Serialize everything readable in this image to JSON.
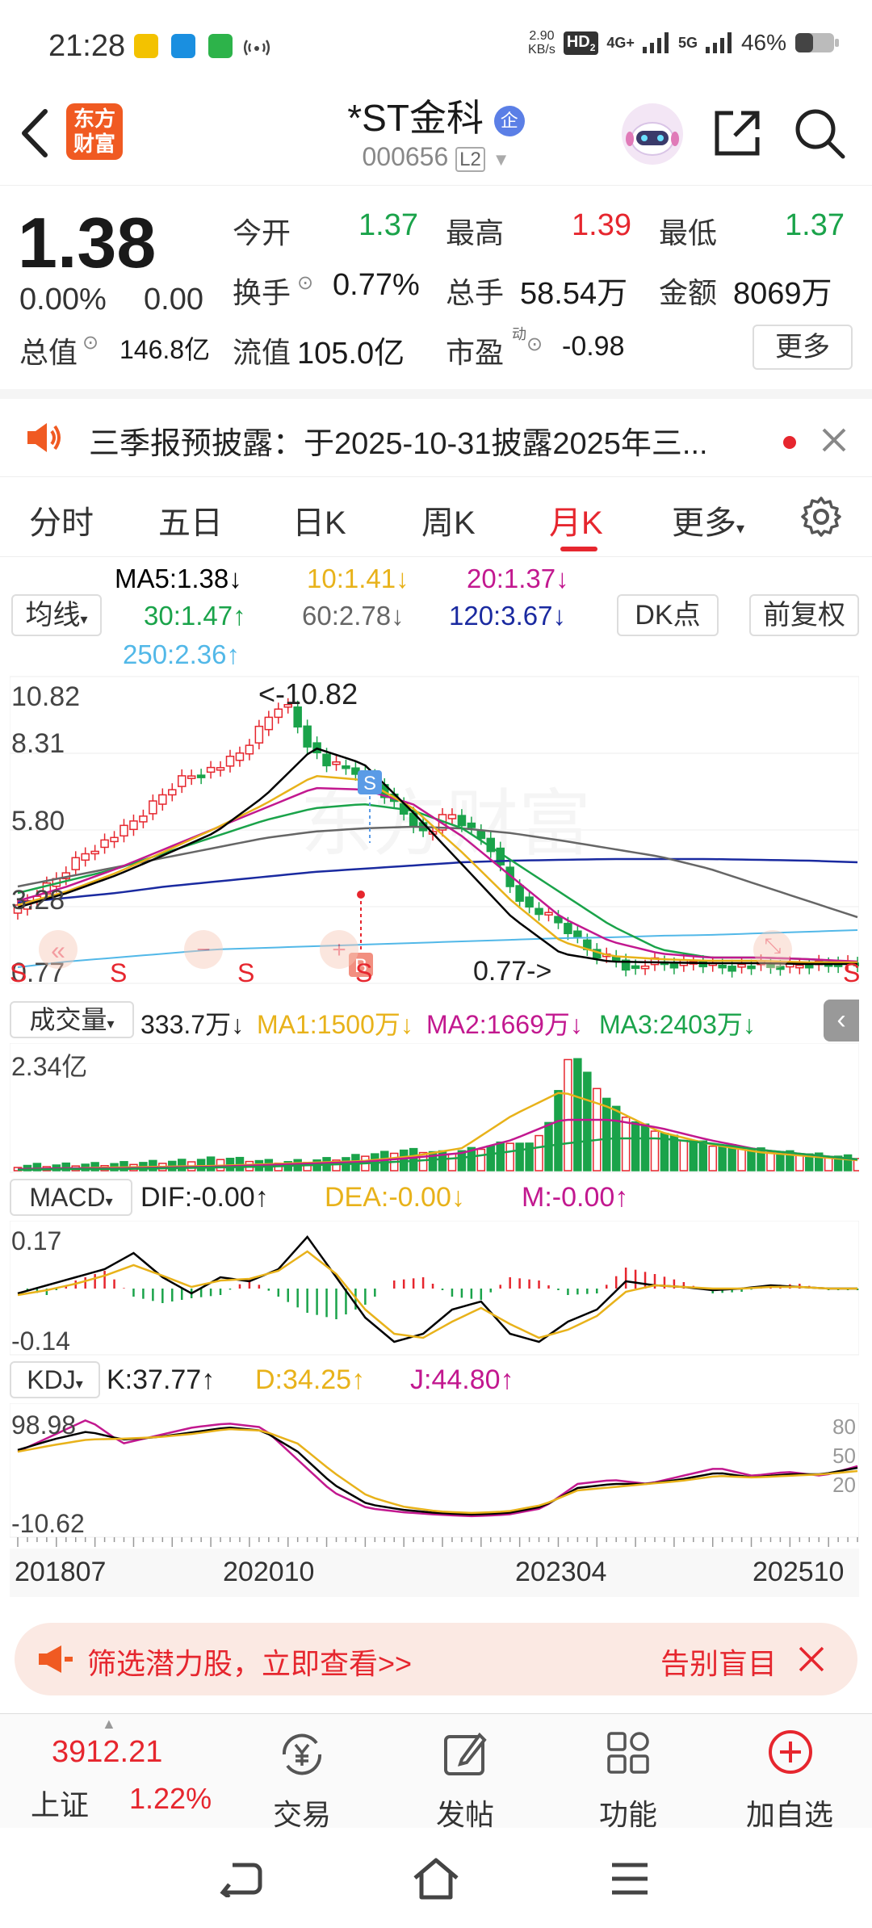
{
  "status_bar": {
    "time": "21:28",
    "net_speed_value": "2.90",
    "net_speed_unit": "KB/s",
    "hd_label": "HD",
    "hd_sub": "2",
    "net_4g": "4G+",
    "net_5g": "5G",
    "battery": "46%"
  },
  "header": {
    "logo_line1": "东方",
    "logo_line2": "财富",
    "title": "*ST金科",
    "title_badge": "企",
    "code": "000656",
    "level_badge": "L2"
  },
  "quote": {
    "price": "1.38",
    "change_pct": "0.00%",
    "change_amt": "0.00",
    "open_label": "今开",
    "open_value": "1.37",
    "high_label": "最高",
    "high_value": "1.39",
    "low_label": "最低",
    "low_value": "1.37",
    "turnover_label": "换手",
    "turnover_value": "0.77%",
    "volume_label": "总手",
    "volume_value": "58.54万",
    "amount_label": "金额",
    "amount_value": "8069万",
    "mktcap_label": "总值",
    "mktcap_value": "146.8亿",
    "float_label": "流值",
    "float_value": "105.0亿",
    "pe_label": "市盈",
    "pe_sup": "动",
    "pe_value": "-0.98",
    "more_button": "更多"
  },
  "notice": {
    "text": "三季报预披露：于2025-10-31披露2025年三..."
  },
  "tabs": [
    {
      "label": "分时"
    },
    {
      "label": "五日"
    },
    {
      "label": "日K"
    },
    {
      "label": "周K"
    },
    {
      "label": "月K"
    },
    {
      "label": "更多"
    }
  ],
  "ma_legend": {
    "indicator_select": "均线",
    "ma5": "MA5:1.38↓",
    "ma10": "10:1.41↓",
    "ma20": "20:1.37↓",
    "ma30": "30:1.47↑",
    "ma60": "60:2.78↓",
    "ma120": "120:3.67↓",
    "ma250": "250:2.36↑",
    "dk_button": "DK点",
    "adjust_button": "前复权"
  },
  "colors": {
    "up": "#e6262e",
    "down": "#1aa34a",
    "ma5": "#000000",
    "ma10": "#e8b21a",
    "ma20": "#c2188f",
    "ma30": "#1aa34a",
    "ma60": "#666666",
    "ma120": "#1a2aa0",
    "ma250": "#52b8e8"
  },
  "main_chart": {
    "y_max": "10.82",
    "y_2": "8.31",
    "y_3": "5.80",
    "y_4": "3.28",
    "y_min": "0.77",
    "high_marker": "<-10.82",
    "low_marker": "0.77->",
    "s_marker": "S",
    "b_marker": "B"
  },
  "volume": {
    "select": "成交量",
    "value": "333.7万↓",
    "ma1": "MA1:1500万↓",
    "ma2": "MA2:1669万↓",
    "ma3": "MA3:2403万↓",
    "y_max": "2.34亿"
  },
  "macd": {
    "select": "MACD",
    "dif": "DIF:-0.00↑",
    "dea": "DEA:-0.00↓",
    "m": "M:-0.00↑",
    "y_max": "0.17",
    "y_min": "-0.14"
  },
  "kdj": {
    "select": "KDJ",
    "k": "K:37.77↑",
    "d": "D:34.25↑",
    "j": "J:44.80↑",
    "y_max": "98.98",
    "y_min": "-10.62",
    "r80": "80",
    "r50": "50",
    "r20": "20"
  },
  "x_axis": [
    "201807",
    "202010",
    "202304",
    "202510"
  ],
  "ad_banner": {
    "text": "筛选潜力股，立即查看>>",
    "side_text": "告别盲目"
  },
  "bottom_nav": {
    "index_value": "3912.21",
    "index_name": "上证",
    "index_change": "1.22%",
    "trade": "交易",
    "post": "发帖",
    "functions": "功能",
    "add_watch": "加自选"
  }
}
